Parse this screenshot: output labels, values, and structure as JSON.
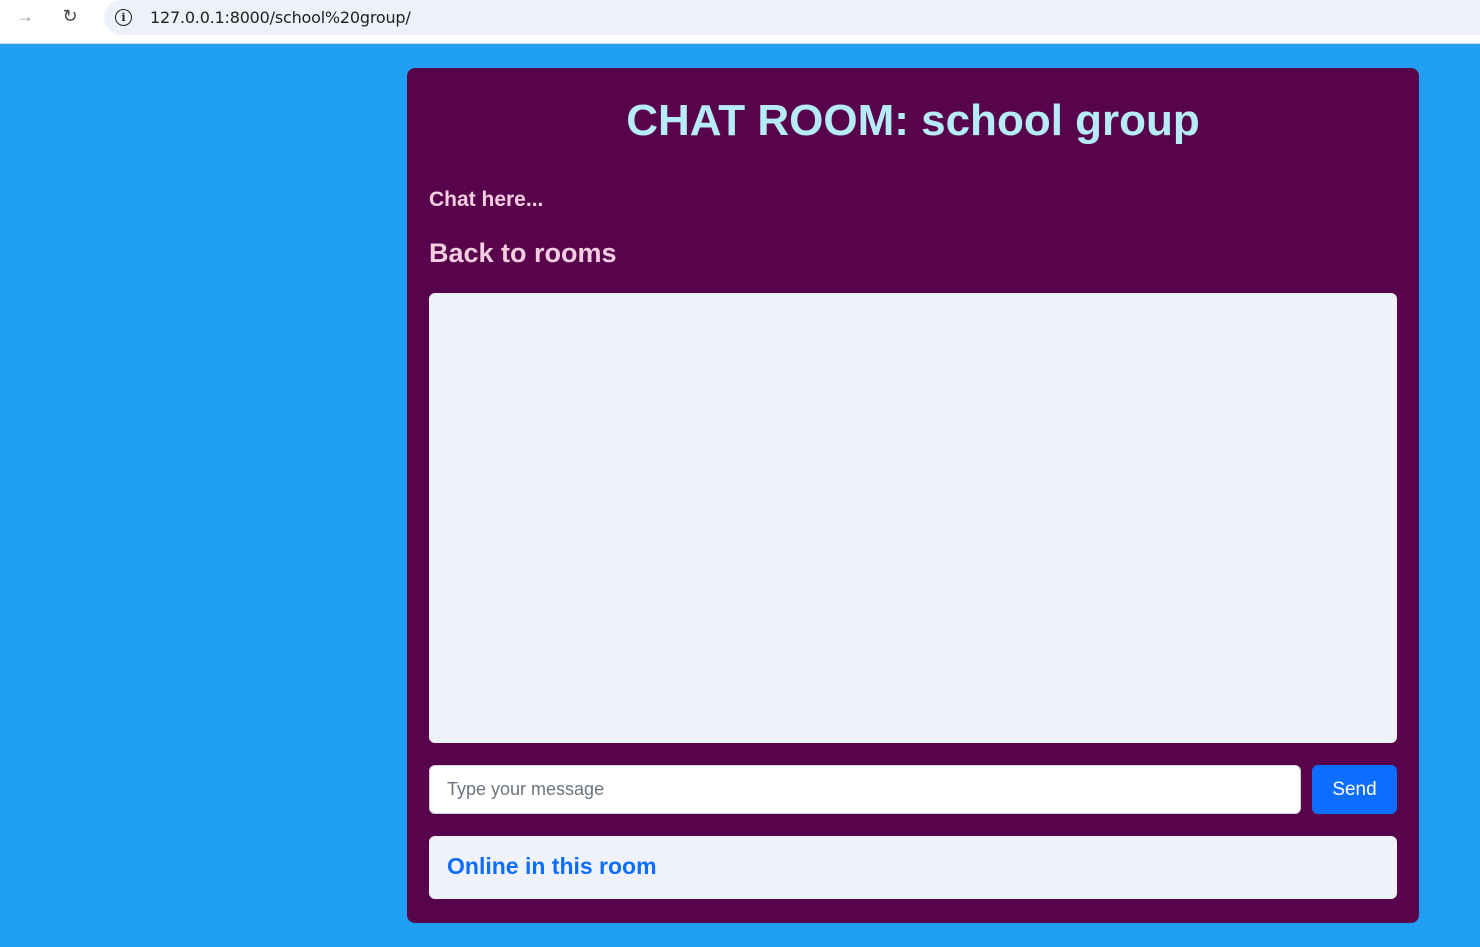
{
  "browser": {
    "url": "127.0.0.1:8000/school%20group/",
    "forward_icon": "arrow-right-icon",
    "reload_icon": "reload-icon",
    "site_info_icon": "info-icon"
  },
  "chat": {
    "title": "CHAT ROOM: school group",
    "hint": "Chat here...",
    "back_link": "Back to rooms",
    "input_placeholder": "Type your message",
    "input_value": "",
    "send_label": "Send",
    "online_title": "Online in this room",
    "messages": [],
    "online_users": []
  },
  "colors": {
    "page_background": "#219ff3",
    "card_background": "#58044c",
    "title_color": "#b5ecf8",
    "link_color": "#f7cde0",
    "panel_background": "#eff2f8",
    "accent": "#0d6efd"
  }
}
